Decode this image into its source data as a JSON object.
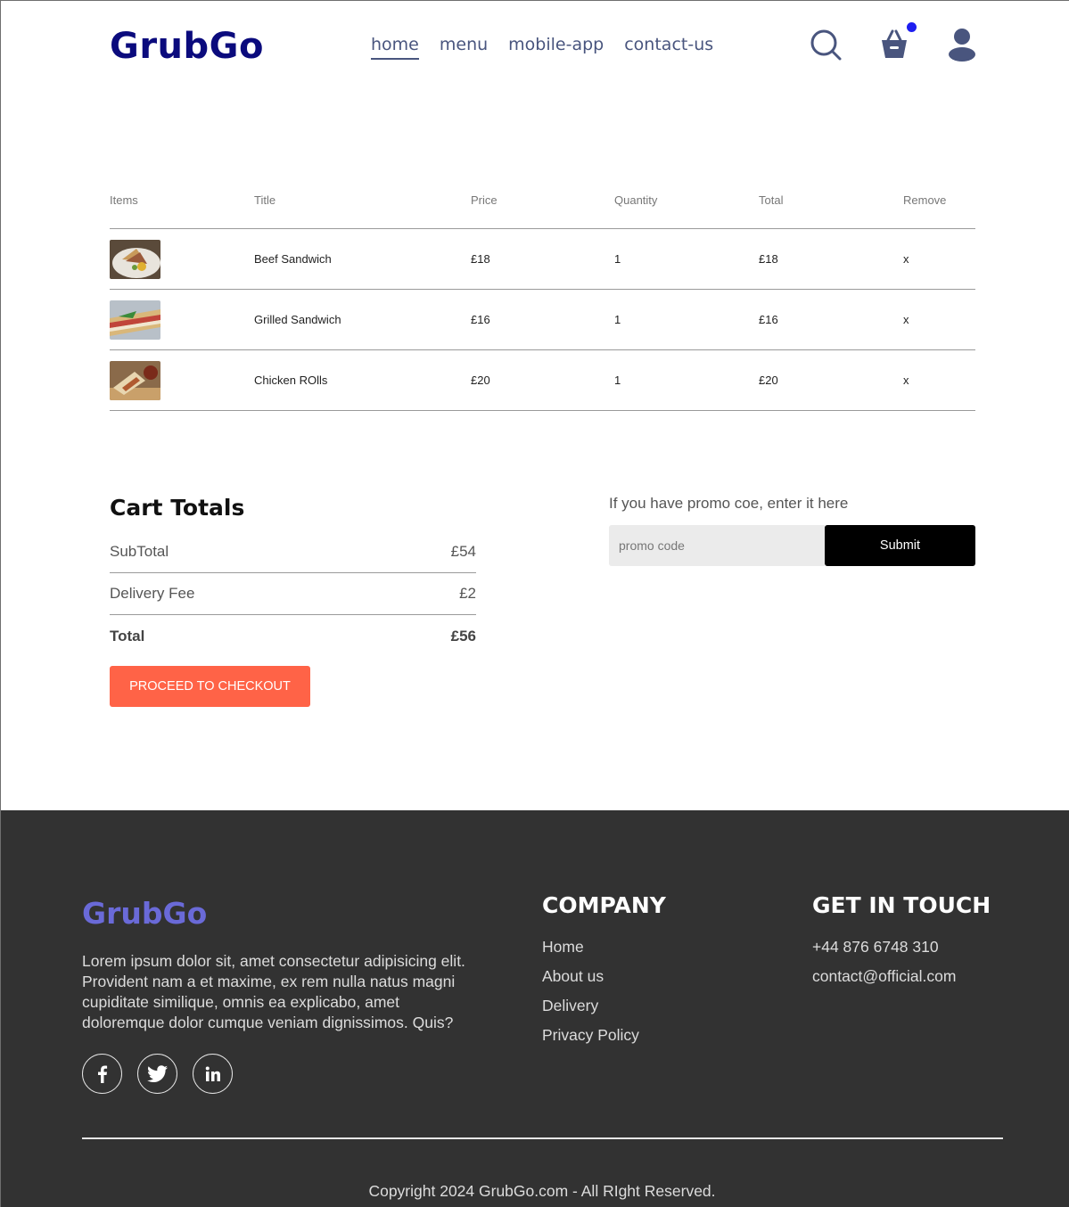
{
  "header": {
    "logo": "GrubGo",
    "nav": [
      "home",
      "menu",
      "mobile-app",
      "contact-us"
    ],
    "active_nav": "home",
    "icons": [
      "search-icon",
      "basket-icon",
      "profile-icon"
    ]
  },
  "cart": {
    "headers": [
      "Items",
      "Title",
      "Price",
      "Quantity",
      "Total",
      "Remove"
    ],
    "rows": [
      {
        "title": "Beef Sandwich",
        "price": "£18",
        "quantity": "1",
        "total": "£18",
        "remove": "x"
      },
      {
        "title": "Grilled Sandwich",
        "price": "£16",
        "quantity": "1",
        "total": "£16",
        "remove": "x"
      },
      {
        "title": "Chicken ROlls",
        "price": "£20",
        "quantity": "1",
        "total": "£20",
        "remove": "x"
      }
    ]
  },
  "totals": {
    "heading": "Cart Totals",
    "subtotal_label": "SubTotal",
    "subtotal_value": "£54",
    "delivery_label": "Delivery Fee",
    "delivery_value": "£2",
    "total_label": "Total",
    "total_value": "£56",
    "checkout_label": "PROCEED TO CHECKOUT"
  },
  "promo": {
    "prompt": "If you have promo coe, enter it here",
    "placeholder": "promo code",
    "submit_label": "Submit"
  },
  "footer": {
    "logo": "GrubGo",
    "description": "Lorem ipsum dolor sit, amet consectetur adipisicing elit. Provident nam a et maxime, ex rem nulla natus magni cupiditate similique, omnis ea explicabo, amet doloremque dolor cumque veniam dignissimos. Quis?",
    "social_icons": [
      "facebook-icon",
      "twitter-icon",
      "linkedin-icon"
    ],
    "company_heading": "COMPANY",
    "company_links": [
      "Home",
      "About us",
      "Delivery",
      "Privacy Policy"
    ],
    "contact_heading": "GET IN TOUCH",
    "phone": "+44 876 6748 310",
    "email": "contact@official.com",
    "copyright": "Copyright 2024 GrubGo.com - All RIght Reserved."
  },
  "colors": {
    "brand": "#0b0b7d",
    "nav": "#49557e",
    "accent": "#ff6347",
    "cart_dot": "#1e1ef0",
    "footer_bg": "#323232",
    "footer_logo": "#6a6ad8"
  }
}
